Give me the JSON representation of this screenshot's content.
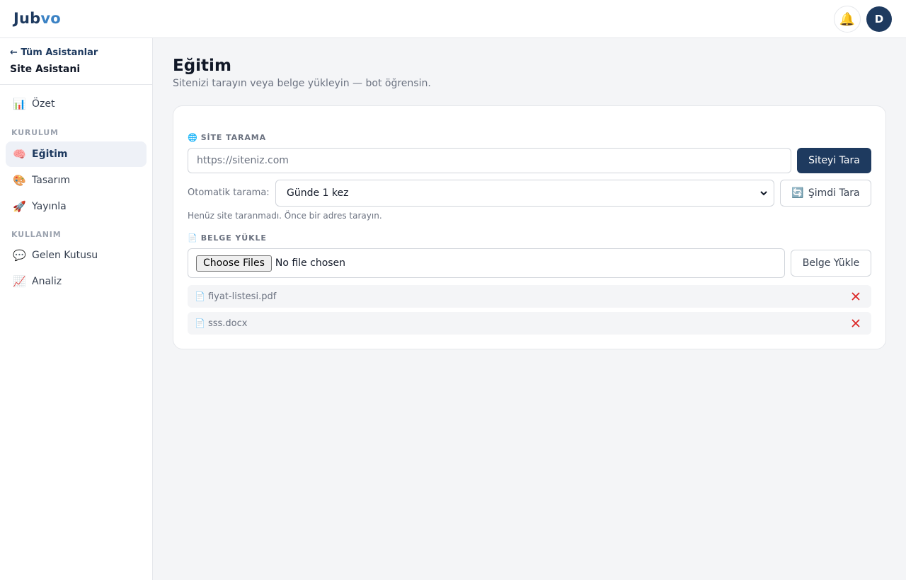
{
  "brand": {
    "name_part1": "Jub",
    "name_part2": "vo",
    "accent": "#3b82c4",
    "primary": "#1e3a5f"
  },
  "header": {
    "notification_icon": "bell-icon",
    "avatar_initial": "D"
  },
  "sidebar": {
    "back_label": "← Tüm Asistanlar",
    "assistant_name": "Site Asistani",
    "top_items": [
      {
        "icon": "📊",
        "label": "Özet"
      }
    ],
    "sections": [
      {
        "title": "KURULUM",
        "items": [
          {
            "icon": "🧠",
            "label": "Eğitim",
            "active": true
          },
          {
            "icon": "🎨",
            "label": "Tasarım"
          },
          {
            "icon": "🚀",
            "label": "Yayınla"
          }
        ]
      },
      {
        "title": "KULLANIM",
        "items": [
          {
            "icon": "💬",
            "label": "Gelen Kutusu"
          },
          {
            "icon": "📈",
            "label": "Analiz"
          }
        ]
      }
    ]
  },
  "main": {
    "title": "Eğitim",
    "subtitle": "Sitenizi tarayın veya belge yükleyin — bot öğrensin.",
    "site_scan": {
      "icon": "🌐",
      "label": "SİTE TARAMA",
      "url_placeholder": "https://siteniz.com",
      "url_value": "",
      "scan_button": "Siteyi Tara",
      "auto_label": "Otomatik tarama:",
      "schedule_selected": "Günde 1 kez",
      "rescan_icon": "🔄",
      "rescan_button": "Şimdi Tara",
      "status": "Henüz site taranmadı. Önce bir adres tarayın."
    },
    "upload": {
      "icon": "📄",
      "label": "BELGE YÜKLE",
      "choose_button": "Choose Files",
      "no_file_text": "No file chosen",
      "upload_button": "Belge Yükle",
      "documents": [
        {
          "icon": "📄",
          "name": "fiyat-listesi.pdf"
        },
        {
          "icon": "📄",
          "name": "sss.docx"
        }
      ],
      "remove_color": "#dc2626"
    }
  }
}
